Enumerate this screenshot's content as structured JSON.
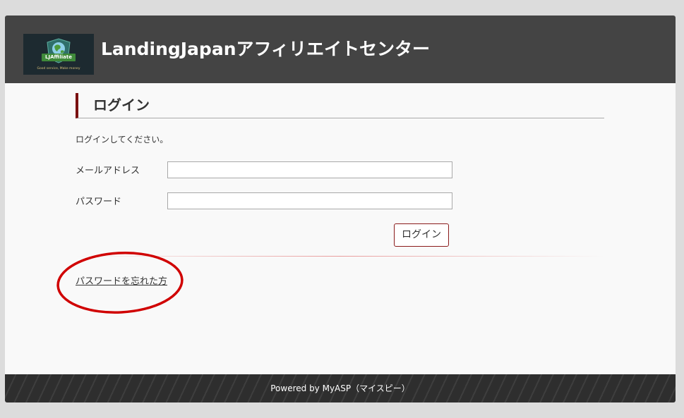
{
  "header": {
    "title": "LandingJapanアフィリエイトセンター",
    "logo": {
      "name": "LJAffiliate",
      "tagline": "Good service, Make money",
      "icon": "globe-shield-icon"
    }
  },
  "login": {
    "heading": "ログイン",
    "instruction": "ログインしてください。",
    "email": {
      "label": "メールアドレス",
      "value": "",
      "placeholder": ""
    },
    "password": {
      "label": "パスワード",
      "value": "",
      "placeholder": ""
    },
    "submit_label": "ログイン",
    "forgot_label": "パスワードを忘れた方"
  },
  "footer": {
    "text": "Powered by MyASP（マイスピー）"
  },
  "colors": {
    "header_bg": "#444444",
    "accent": "#7a1010",
    "annotation": "#d00000",
    "footer_bg": "#2e2e2e"
  }
}
